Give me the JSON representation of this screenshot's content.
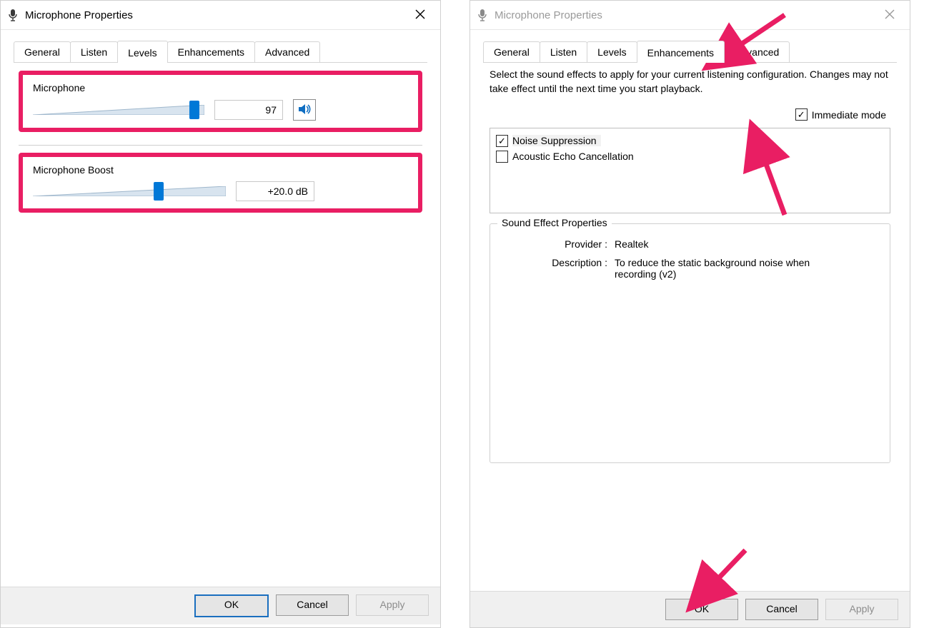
{
  "window_title": "Microphone Properties",
  "tabs": {
    "general": "General",
    "listen": "Listen",
    "levels": "Levels",
    "enhancements": "Enhancements",
    "advanced": "Advanced"
  },
  "levels": {
    "mic_label": "Microphone",
    "mic_value": "97",
    "mic_pct": 97,
    "boost_label": "Microphone Boost",
    "boost_value": "+20.0 dB",
    "boost_pct": 66
  },
  "enhancements": {
    "description": "Select the sound effects to apply for your current listening configuration. Changes may not take effect until the next time you start playback.",
    "immediate_mode_label": "Immediate mode",
    "options": {
      "noise_suppression": "Noise Suppression",
      "echo_cancel": "Acoustic Echo Cancellation"
    },
    "group_title": "Sound Effect Properties",
    "provider_k": "Provider :",
    "provider_v": "Realtek",
    "description_k": "Description :",
    "description_v": "To reduce the static background noise when recording (v2)"
  },
  "buttons": {
    "ok": "OK",
    "cancel": "Cancel",
    "apply": "Apply"
  },
  "colors": {
    "accent": "#0078d7",
    "highlight": "#e91e63",
    "arrow": "#e91e63"
  }
}
